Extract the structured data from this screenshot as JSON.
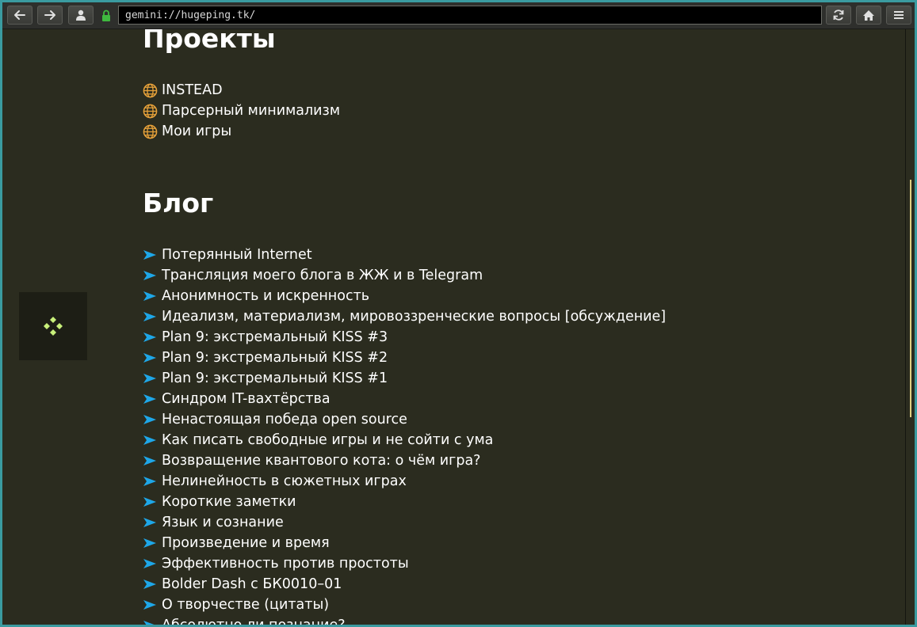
{
  "toolbar": {
    "url": "gemini://hugeping.tk/",
    "back_icon": "arrow-left-icon",
    "forward_icon": "arrow-right-icon",
    "identity_icon": "user-icon",
    "lock_icon": "lock-icon",
    "reload_icon": "reload-icon",
    "home_icon": "home-icon",
    "menu_icon": "hamburger-menu-icon"
  },
  "colors": {
    "background": "#2b2c1f",
    "window_border": "#3a9ba0",
    "link_arrow": "#1ea7e8",
    "globe": "#e8a23a",
    "logo": "#c8f07a"
  },
  "projects": {
    "heading": "Проекты",
    "icon": "globe-icon",
    "items": [
      "INSTEAD",
      "Парсерный минимализм",
      "Мои игры"
    ]
  },
  "blog": {
    "heading": "Блог",
    "icon": "arrow-right-icon",
    "items": [
      "Потерянный Internet",
      "Трансляция моего блога в ЖЖ и в Telegram",
      "Анонимность и искренность",
      "Идеализм, материализм, мировоззренческие вопросы [обсуждение]",
      "Plan 9: экстремальный KISS #3",
      "Plan 9: экстремальный KISS #2",
      "Plan 9: экстремальный KISS #1",
      "Синдром IT-вахтёрства",
      "Ненастоящая победа open source",
      "Как писать свободные игры и не сойти с ума",
      "Возвращение квантового кота: о чём игра?",
      "Нелинейность в сюжетных играх",
      "Короткие заметки",
      "Язык и сознание",
      "Произведение и время",
      "Эффективность против простоты",
      "Bolder Dash с БК0010–01",
      "О творчестве (цитаты)",
      "Абсолютно ли познание?"
    ]
  }
}
